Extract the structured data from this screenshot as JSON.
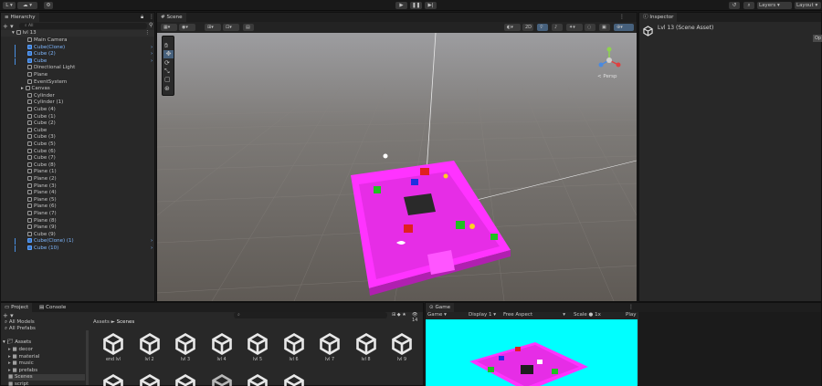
{
  "toolbar": {
    "account_label": "L",
    "layers_label": "Layers",
    "layout_label": "Layout"
  },
  "hierarchy": {
    "tab_label": "Hierarchy",
    "search_placeholder": "All",
    "scene_name": "lvl 13",
    "items": [
      {
        "label": "Main Camera",
        "type": "camera",
        "blue": false
      },
      {
        "label": "Cube(Clone)",
        "type": "cube",
        "blue": true
      },
      {
        "label": "Cube (2)",
        "type": "cube",
        "blue": true
      },
      {
        "label": "Cube",
        "type": "cube",
        "blue": true
      },
      {
        "label": "Directional Light",
        "type": "light",
        "blue": false
      },
      {
        "label": "Plane",
        "type": "cube",
        "blue": false
      },
      {
        "label": "EventSystem",
        "type": "cube",
        "blue": false
      },
      {
        "label": "Canvas",
        "type": "cube",
        "blue": false
      },
      {
        "label": "Cylinder",
        "type": "cube",
        "blue": false
      },
      {
        "label": "Cylinder (1)",
        "type": "cube",
        "blue": false
      },
      {
        "label": "Cube (4)",
        "type": "cube",
        "blue": false
      },
      {
        "label": "Cube (1)",
        "type": "cube",
        "blue": false
      },
      {
        "label": "Cube (2)",
        "type": "cube",
        "blue": false
      },
      {
        "label": "Cube",
        "type": "cube",
        "blue": false
      },
      {
        "label": "Cube (3)",
        "type": "cube",
        "blue": false
      },
      {
        "label": "Cube (5)",
        "type": "cube",
        "blue": false
      },
      {
        "label": "Cube (6)",
        "type": "cube",
        "blue": false
      },
      {
        "label": "Cube (7)",
        "type": "cube",
        "blue": false
      },
      {
        "label": "Cube (8)",
        "type": "cube",
        "blue": false
      },
      {
        "label": "Plane (1)",
        "type": "cube",
        "blue": false
      },
      {
        "label": "Plane (2)",
        "type": "cube",
        "blue": false
      },
      {
        "label": "Plane (3)",
        "type": "cube",
        "blue": false
      },
      {
        "label": "Plane (4)",
        "type": "cube",
        "blue": false
      },
      {
        "label": "Plane (5)",
        "type": "cube",
        "blue": false
      },
      {
        "label": "Plane (6)",
        "type": "cube",
        "blue": false
      },
      {
        "label": "Plane (7)",
        "type": "cube",
        "blue": false
      },
      {
        "label": "Plane (8)",
        "type": "cube",
        "blue": false
      },
      {
        "label": "Plane (9)",
        "type": "cube",
        "blue": false
      },
      {
        "label": "Cube (9)",
        "type": "cube",
        "blue": false
      },
      {
        "label": "Cube(Clone) (1)",
        "type": "cube",
        "blue": true
      },
      {
        "label": "Cube (10)",
        "type": "cube",
        "blue": true
      }
    ]
  },
  "scene": {
    "tab_label": "Scene",
    "mode_2d": "2D",
    "persp_label": "< Persp"
  },
  "inspector": {
    "tab_label": "Inspector",
    "title": "Lvl 13 (Scene Asset)",
    "open_label": "Op"
  },
  "project": {
    "tab_label": "Project",
    "console_tab": "Console",
    "count": "14",
    "breadcrumb_root": "Assets",
    "breadcrumb_sep": "►",
    "breadcrumb_current": "Scenes",
    "favorites": [
      "All Models",
      "All Prefabs"
    ],
    "tree_root": "Assets",
    "folders": [
      "decor",
      "material",
      "music",
      "prefabs",
      "Scenes",
      "script"
    ],
    "assets_row1": [
      "end lvl",
      "lvl 2",
      "lvl 3",
      "lvl 4",
      "lvl 5",
      "lvl 6",
      "lvl 7",
      "lvl 8",
      "lvl 9"
    ],
    "assets_row2_count": 6
  },
  "game": {
    "tab_label": "Game",
    "display_mode": "Game",
    "display": "Display 1",
    "aspect": "Free Aspect",
    "scale_label": "Scale",
    "scale_value": "1x",
    "play_label": "Play"
  },
  "colors": {
    "magenta": "#ff33ff",
    "cyan": "#00ffff",
    "scene_bg": "#6a6560",
    "accent_blue": "#4a90e2"
  }
}
